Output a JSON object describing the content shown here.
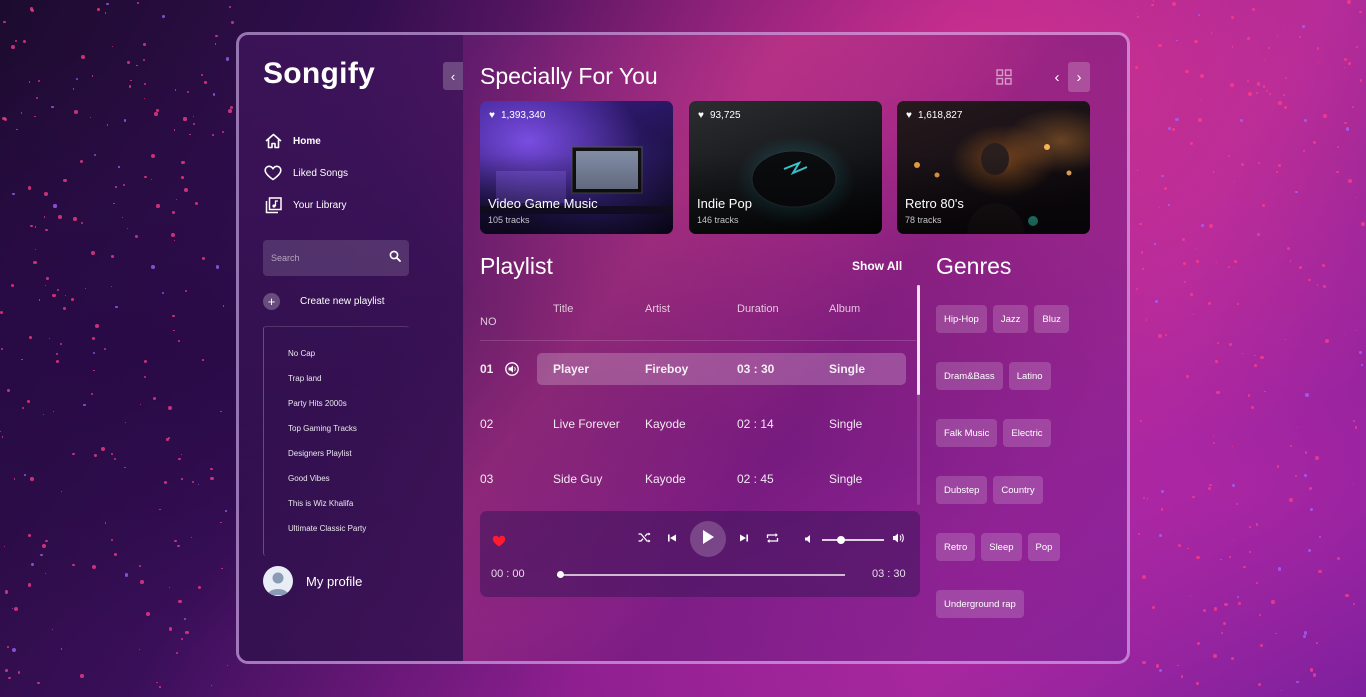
{
  "app": {
    "logo": "Songify",
    "collapse_icon": "chevron-left"
  },
  "nav": {
    "items": [
      {
        "label": "Home",
        "icon": "home-icon",
        "active": true
      },
      {
        "label": "Liked Songs",
        "icon": "heart-icon",
        "active": false
      },
      {
        "label": "Your Library",
        "icon": "library-icon",
        "active": false
      }
    ]
  },
  "search": {
    "placeholder": "Search"
  },
  "create_playlist": {
    "label": "Create new playlist"
  },
  "playlists": [
    "No Cap",
    "Trap land",
    "Party Hits 2000s",
    "Top Gaming Tracks",
    "Designers Playlist",
    "Good Vibes",
    "This is Wiz Khalifa",
    "Ultimate Classic Party"
  ],
  "profile": {
    "label": "My profile"
  },
  "for_you": {
    "title": "Specially For You",
    "cards": [
      {
        "likes": "1,393,340",
        "name": "Video Game Music",
        "tracks": "105 tracks"
      },
      {
        "likes": "93,725",
        "name": "Indie Pop",
        "tracks": "146 tracks"
      },
      {
        "likes": "1,618,827",
        "name": "Retro 80's",
        "tracks": "78 tracks"
      }
    ]
  },
  "playlist": {
    "title": "Playlist",
    "show_all": "Show All",
    "columns": [
      "NO",
      "Title",
      "Artist",
      "Duration",
      "Album"
    ],
    "rows": [
      {
        "no": "01",
        "title": "Player",
        "artist": "Fireboy",
        "duration": "03 : 30",
        "album": "Single",
        "playing": true
      },
      {
        "no": "02",
        "title": "Live Forever",
        "artist": "Kayode",
        "duration": "02 : 14",
        "album": "Single",
        "playing": false
      },
      {
        "no": "03",
        "title": "Side Guy",
        "artist": "Kayode",
        "duration": "02 : 45",
        "album": "Single",
        "playing": false
      }
    ]
  },
  "player": {
    "current_time": "00 : 00",
    "total_time": "03 : 30",
    "progress": 0,
    "volume": 0.3,
    "liked": true,
    "heart_color": "#ff1b2e"
  },
  "genres": {
    "title": "Genres",
    "rows": [
      [
        "Hip-Hop",
        "Jazz",
        "Bluz"
      ],
      [
        "Dram&Bass",
        "Latino"
      ],
      [
        "Falk Music",
        "Electric"
      ],
      [
        "Dubstep",
        "Country"
      ],
      [
        "Retro",
        "Sleep",
        "Pop"
      ],
      [
        "Underground rap"
      ]
    ]
  }
}
